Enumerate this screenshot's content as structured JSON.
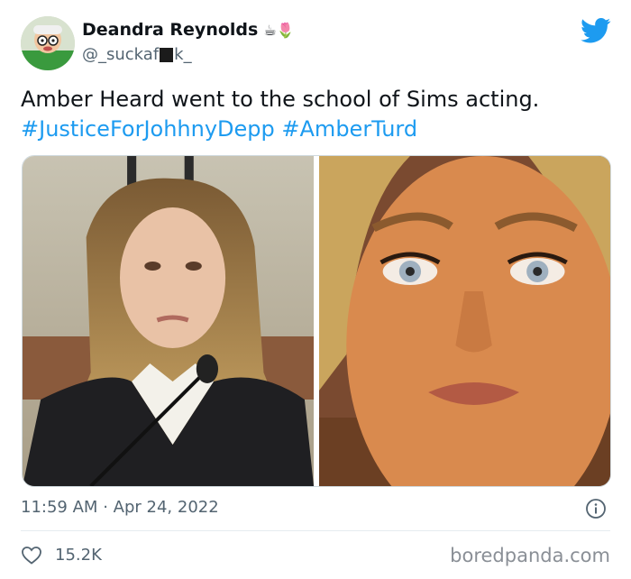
{
  "author": {
    "name": "Deandra Reynolds",
    "name_emojis": "☕🌷",
    "handle_start": "@_suckaf",
    "handle_end": "k_",
    "avatar_icon": "cartoon-avatar"
  },
  "tweet": {
    "text": "Amber Heard went to the school of Sims acting.",
    "hashtags": [
      "#JusticeForJohhnyDepp",
      "#AmberTurd"
    ],
    "time": "11:59 AM",
    "separator": "·",
    "date": "Apr 24, 2022",
    "likes": "15.2K"
  },
  "media": {
    "left": "courtroom-photo",
    "right": "sims-character-face"
  },
  "watermark": "boredpanda.com",
  "colors": {
    "link": "#1d9bf0",
    "brand": "#1d9bf0",
    "muted": "#536471"
  }
}
